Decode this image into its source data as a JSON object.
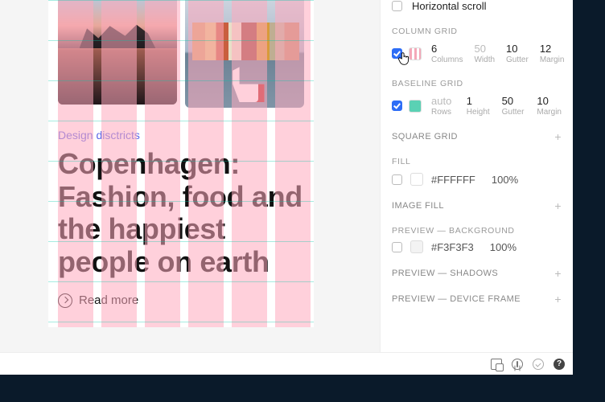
{
  "article": {
    "kicker": "Design disctricts",
    "headline": "Copenhagen: Fashion, food and the happiest people on earth",
    "read_more": "Read more"
  },
  "inspector": {
    "hscroll": {
      "label": "Horizontal scroll",
      "checked": false
    },
    "column_grid": {
      "title": "COLUMN GRID",
      "checked": true,
      "columns": {
        "value": "6",
        "label": "Columns"
      },
      "width": {
        "value": "50",
        "label": "Width"
      },
      "gutter": {
        "value": "10",
        "label": "Gutter"
      },
      "margin": {
        "value": "12",
        "label": "Margin"
      }
    },
    "baseline_grid": {
      "title": "BASELINE GRID",
      "checked": true,
      "rows": {
        "value": "auto",
        "label": "Rows"
      },
      "height": {
        "value": "1",
        "label": "Height"
      },
      "gutter": {
        "value": "50",
        "label": "Gutter"
      },
      "margin": {
        "value": "10",
        "label": "Margin"
      }
    },
    "square_grid": {
      "title": "SQUARE GRID"
    },
    "fill": {
      "title": "FILL",
      "hex": "#FFFFFF",
      "opacity": "100%"
    },
    "image_fill": {
      "title": "IMAGE FILL"
    },
    "preview_bg": {
      "title": "PREVIEW — BACKGROUND",
      "hex": "#F3F3F3",
      "opacity": "100%"
    },
    "preview_shadows": {
      "title": "PREVIEW — SHADOWS"
    },
    "preview_device": {
      "title": "PREVIEW — DEVICE FRAME"
    }
  },
  "status_icons": {
    "frame": "device-frame-icon",
    "a11y": "accessibility-icon",
    "check": "check-icon",
    "help": "?"
  }
}
